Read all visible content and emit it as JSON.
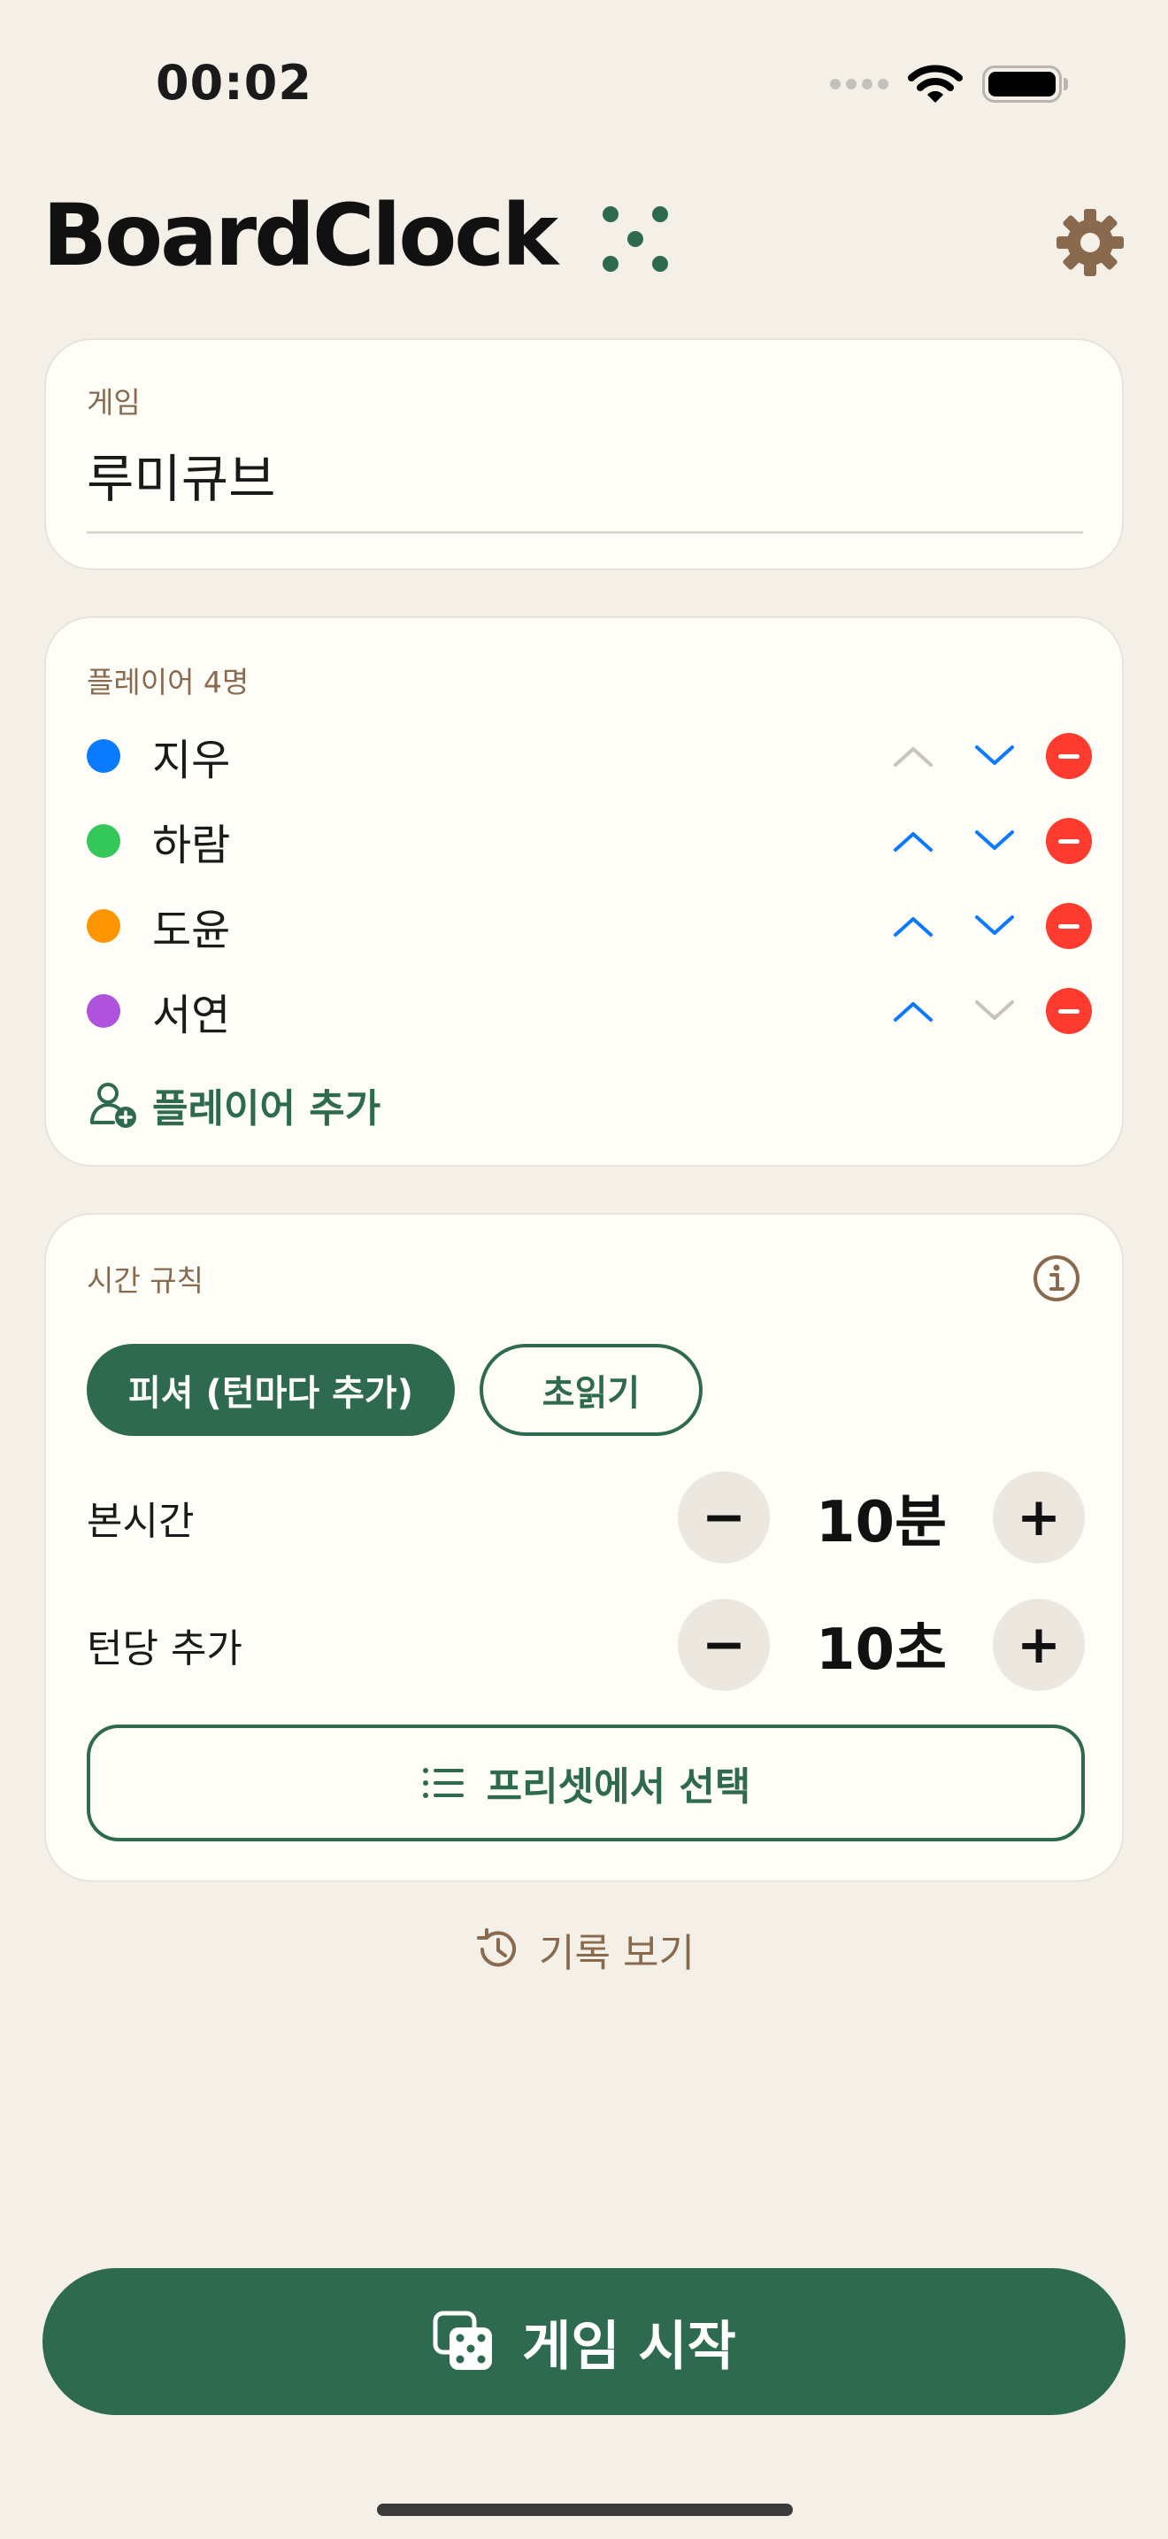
{
  "status_bar": {
    "time": "00:02"
  },
  "header": {
    "title": "BoardClock",
    "logo_icon": "dice-five-dots-icon",
    "settings_icon": "gear-icon"
  },
  "game": {
    "label": "게임",
    "value": "루미큐브"
  },
  "players": {
    "label": "플레이어 4명",
    "items": [
      {
        "name": "지우",
        "color": "#0a7aff",
        "up_enabled": false,
        "down_enabled": true
      },
      {
        "name": "하람",
        "color": "#34c759",
        "up_enabled": true,
        "down_enabled": true
      },
      {
        "name": "도윤",
        "color": "#ff9500",
        "up_enabled": true,
        "down_enabled": true
      },
      {
        "name": "서연",
        "color": "#af52de",
        "up_enabled": true,
        "down_enabled": false
      }
    ],
    "add_label": "플레이어 추가"
  },
  "time_rules": {
    "label": "시간 규칙",
    "modes": [
      {
        "label": "피셔 (턴마다 추가)",
        "selected": true
      },
      {
        "label": "초읽기",
        "selected": false
      }
    ],
    "main_time": {
      "label": "본시간",
      "value": "10분"
    },
    "increment": {
      "label": "턴당 추가",
      "value": "10초"
    },
    "preset_label": "프리셋에서 선택"
  },
  "history_label": "기록 보기",
  "start_label": "게임 시작",
  "colors": {
    "accent": "#2d6a4f",
    "brown": "#8a6a4e",
    "blue": "#0a7aff",
    "red": "#ff3b30",
    "background": "#f4f0e8"
  }
}
